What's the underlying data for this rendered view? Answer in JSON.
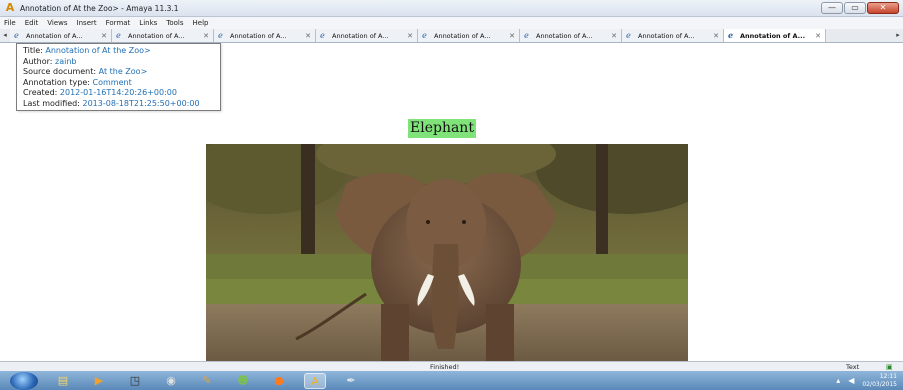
{
  "window": {
    "title": "Annotation of At the Zoo> - Amaya 11.3.1",
    "minimize": "—",
    "maximize": "▭",
    "close": "✕"
  },
  "menu": [
    "File",
    "Edit",
    "Views",
    "Insert",
    "Format",
    "Links",
    "Tools",
    "Help"
  ],
  "tabs": [
    {
      "label": "Annotation of A...",
      "close": "✕"
    },
    {
      "label": "Annotation of A...",
      "close": "✕"
    },
    {
      "label": "Annotation of A...",
      "close": "✕"
    },
    {
      "label": "Annotation of A...",
      "close": "✕"
    },
    {
      "label": "Annotation of A...",
      "close": "✕"
    },
    {
      "label": "Annotation of A...",
      "close": "✕"
    },
    {
      "label": "Annotation of A...",
      "close": "✕"
    },
    {
      "label": "Annotation of A...",
      "close": "✕"
    }
  ],
  "annotation": {
    "title_key": "Title: ",
    "title_val": "Annotation of At the Zoo>",
    "author_key": "Author: ",
    "author_val": "zainb",
    "source_key": "Source document: ",
    "source_val": "At the Zoo>",
    "type_key": "Annotation type: ",
    "type_val": "Comment",
    "created_key": "Created: ",
    "created_val": "2012-01-16T14:20:26+00:00",
    "modified_key": "Last modified: ",
    "modified_val": "2013-08-18T21:25:50+00:00"
  },
  "content": {
    "heading": "Elephant",
    "heading_bg": "#7fe37a"
  },
  "status": {
    "message": "Finished!",
    "mode": "Text"
  },
  "taskbar": {
    "clock_time": "12:11",
    "clock_date": "02/03/2015"
  }
}
